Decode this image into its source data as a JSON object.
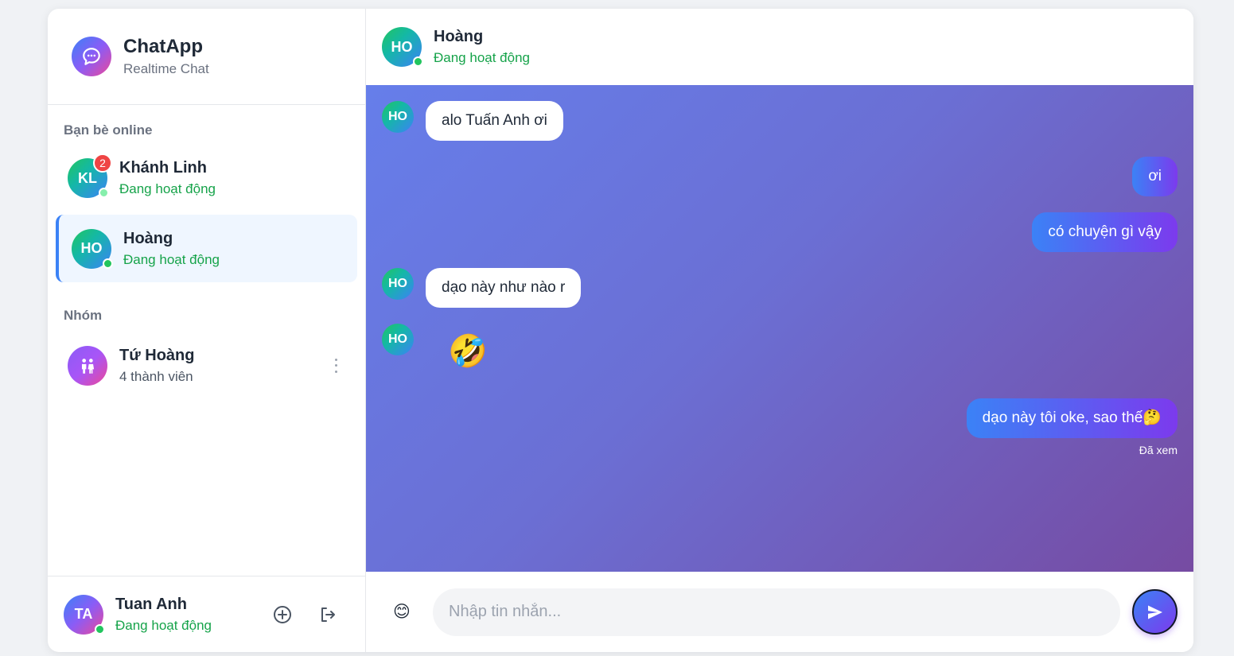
{
  "brand": {
    "title": "ChatApp",
    "subtitle": "Realtime Chat"
  },
  "sidebar": {
    "friends_title": "Bạn bè online",
    "groups_title": "Nhóm",
    "friends": [
      {
        "initials": "KL",
        "name": "Khánh Linh",
        "status": "Đang hoạt động",
        "unread": "2"
      },
      {
        "initials": "HO",
        "name": "Hoàng",
        "status": "Đang hoạt động"
      }
    ],
    "groups": [
      {
        "name": "Tứ Hoàng",
        "members": "4 thành viên"
      }
    ]
  },
  "me": {
    "initials": "TA",
    "name": "Tuan Anh",
    "status": "Đang hoạt động"
  },
  "chat": {
    "header": {
      "initials": "HO",
      "name": "Hoàng",
      "status": "Đang hoạt động"
    },
    "messages": [
      {
        "from": "HO",
        "text": "alo Tuấn Anh ơi"
      },
      {
        "from": "me",
        "text": "ơi"
      },
      {
        "from": "me",
        "text": "có chuyện gì vậy"
      },
      {
        "from": "HO",
        "text": "dạo này như nào r"
      },
      {
        "from": "HO",
        "text": "🤣"
      },
      {
        "from": "me",
        "text": "dạo này tôi oke, sao thế🤔"
      }
    ],
    "seen_label": "Đã xem"
  },
  "composer": {
    "emoji": "😊",
    "placeholder": "Nhập tin nhắn..."
  },
  "colors": {
    "accent": "#3b82f6",
    "online": "#22c55e",
    "badge": "#ef4444",
    "chat_bg_start": "#667eea",
    "chat_bg_end": "#764ba2"
  },
  "icons": [
    "chat-bubble-icon",
    "group-icon",
    "add-circle-icon",
    "logout-icon",
    "emoji-icon",
    "send-icon",
    "more-vertical-icon"
  ]
}
